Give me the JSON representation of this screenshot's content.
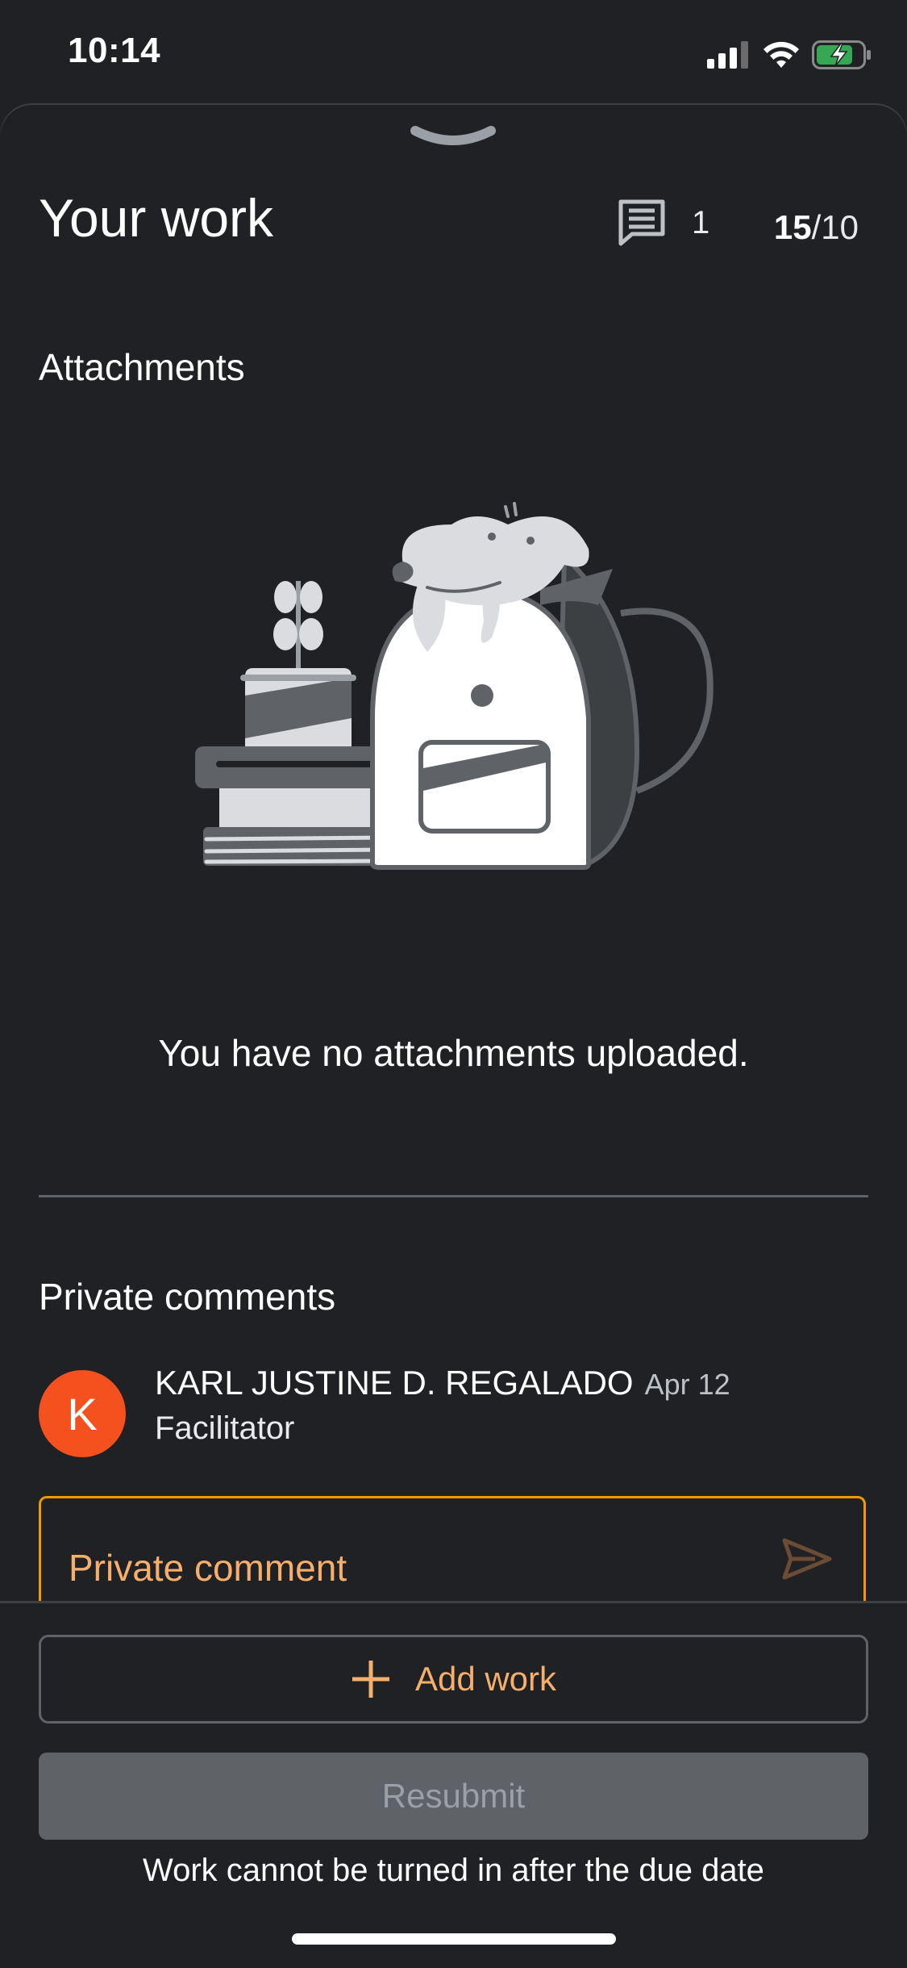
{
  "status_bar": {
    "time": "10:14",
    "icons": [
      "signal-icon",
      "wifi-icon",
      "battery-charging-icon"
    ]
  },
  "header": {
    "title": "Your work",
    "comment_count": "1",
    "grade_points": "15",
    "grade_total": "/10"
  },
  "attachments": {
    "heading": "Attachments",
    "empty_message": "You have no attachments uploaded."
  },
  "private_comments": {
    "heading": "Private comments",
    "comments": [
      {
        "avatar_initial": "K",
        "author": "KARL JUSTINE D. REGALADO",
        "date": "Apr 12",
        "text": "Facilitator"
      }
    ],
    "input_placeholder": "Private comment"
  },
  "actions": {
    "add_work_label": "Add work",
    "resubmit_label": "Resubmit",
    "footnote": "Work cannot be turned in after the due date"
  },
  "colors": {
    "background": "#202124",
    "accent": "#f6ae6b",
    "accent_border": "#f29900",
    "avatar": "#f4511e",
    "battery": "#34a853"
  }
}
